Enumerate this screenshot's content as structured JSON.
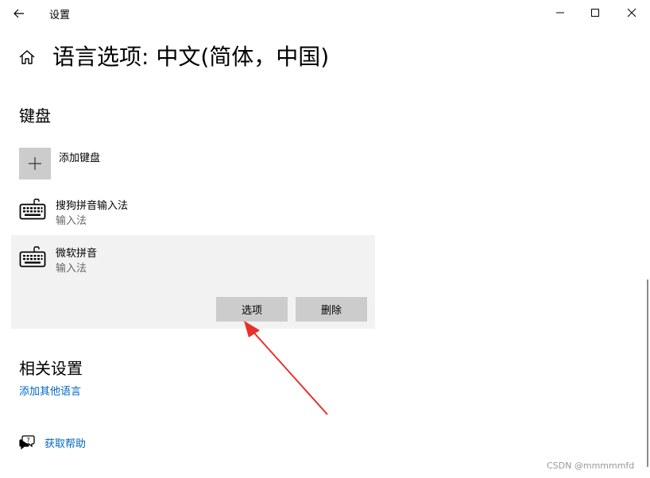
{
  "window": {
    "title": "设置",
    "controls": {
      "minimize": "minimize-icon",
      "maximize": "maximize-icon",
      "close": "close-icon"
    }
  },
  "header": {
    "title": "语言选项: 中文(简体，中国)",
    "icon": "home-icon"
  },
  "keyboard": {
    "heading": "键盘",
    "add_label": "添加键盘",
    "items": [
      {
        "name": "搜狗拼音输入法",
        "type": "输入法",
        "icon": "keyboard-icon"
      },
      {
        "name": "微软拼音",
        "type": "输入法",
        "icon": "keyboard-icon",
        "selected": true,
        "actions": {
          "options": "选项",
          "delete": "删除"
        }
      }
    ]
  },
  "related": {
    "heading": "相关设置",
    "add_language_link": "添加其他语言"
  },
  "help": {
    "label": "获取帮助",
    "icon": "help-chat-icon"
  },
  "watermark": "CSDN @mmmmmfd",
  "colors": {
    "link": "#0067c0",
    "selected_bg": "#f2f2f2",
    "button_bg": "#cccccc",
    "annotation_arrow": "#e8302a"
  }
}
